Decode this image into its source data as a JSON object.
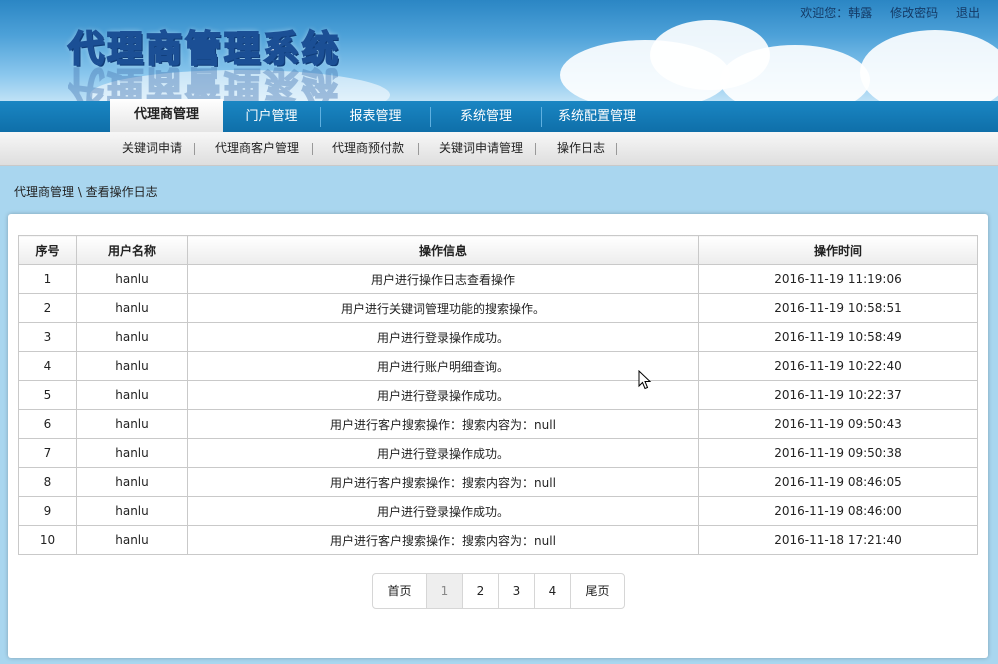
{
  "header": {
    "title": "代理商管理系统",
    "welcome": "欢迎您：韩露",
    "change_password": "修改密码",
    "logout": "退出"
  },
  "main_nav": [
    {
      "label": "代理商管理",
      "active": true
    },
    {
      "label": "门户管理",
      "active": false
    },
    {
      "label": "报表管理",
      "active": false
    },
    {
      "label": "系统管理",
      "active": false
    },
    {
      "label": "系统配置管理",
      "active": false
    }
  ],
  "sub_nav": [
    {
      "label": "关键词申请"
    },
    {
      "label": "代理商客户管理"
    },
    {
      "label": "代理商预付款"
    },
    {
      "label": "关键词申请管理"
    },
    {
      "label": "操作日志"
    }
  ],
  "breadcrumb": "代理商管理 \\ 查看操作日志",
  "table": {
    "columns": [
      "序号",
      "用户名称",
      "操作信息",
      "操作时间"
    ],
    "rows": [
      [
        "1",
        "hanlu",
        "用户进行操作日志查看操作",
        "2016-11-19 11:19:06"
      ],
      [
        "2",
        "hanlu",
        "用户进行关键词管理功能的搜索操作。",
        "2016-11-19 10:58:51"
      ],
      [
        "3",
        "hanlu",
        "用户进行登录操作成功。",
        "2016-11-19 10:58:49"
      ],
      [
        "4",
        "hanlu",
        "用户进行账户明细查询。",
        "2016-11-19 10:22:40"
      ],
      [
        "5",
        "hanlu",
        "用户进行登录操作成功。",
        "2016-11-19 10:22:37"
      ],
      [
        "6",
        "hanlu",
        "用户进行客户搜索操作：搜索内容为：null",
        "2016-11-19 09:50:43"
      ],
      [
        "7",
        "hanlu",
        "用户进行登录操作成功。",
        "2016-11-19 09:50:38"
      ],
      [
        "8",
        "hanlu",
        "用户进行客户搜索操作：搜索内容为：null",
        "2016-11-19 08:46:05"
      ],
      [
        "9",
        "hanlu",
        "用户进行登录操作成功。",
        "2016-11-19 08:46:00"
      ],
      [
        "10",
        "hanlu",
        "用户进行客户搜索操作：搜索内容为：null",
        "2016-11-18 17:21:40"
      ]
    ]
  },
  "pagination": {
    "first": "首页",
    "pages": [
      "1",
      "2",
      "3",
      "4"
    ],
    "current": "1",
    "last": "尾页"
  },
  "colors": {
    "nav_blue": "#0f6fa9",
    "page_bg": "#a9d6ef"
  }
}
